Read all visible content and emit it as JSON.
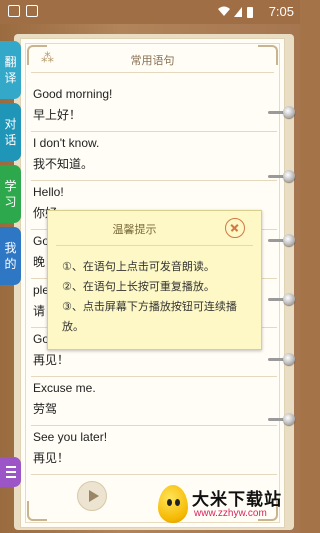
{
  "status_bar": {
    "time": "7:05"
  },
  "book": {
    "title": "常用语句",
    "phrases": [
      {
        "en": "Good morning!",
        "zh": "早上好！"
      },
      {
        "en": "I don't know.",
        "zh": "我不知道。"
      },
      {
        "en": "Hello!",
        "zh": "你好"
      },
      {
        "en": "Go",
        "zh": "晚"
      },
      {
        "en": "ple",
        "zh": "请"
      },
      {
        "en": "Go",
        "zh": "再见！"
      },
      {
        "en": "Excuse me.",
        "zh": "劳驾"
      },
      {
        "en": "See you later!",
        "zh": "再见！"
      }
    ]
  },
  "side_tabs": [
    {
      "label": "翻译",
      "color": "#34a8c8"
    },
    {
      "label": "对话",
      "color": "#1f95b8"
    },
    {
      "label": "学习",
      "color": "#2ea84c"
    },
    {
      "label": "我的",
      "color": "#2e77c4"
    }
  ],
  "menu_icon": "list-icon",
  "tooltip": {
    "title": "温馨提示",
    "lines": [
      "①、在语句上点击可发音朗读。",
      "②、在语句上长按可重复播放。",
      "③、点击屏幕下方播放按钮可连续播放。"
    ]
  },
  "watermark": {
    "name": "大米下载站",
    "url": "www.zzhyw.com"
  }
}
